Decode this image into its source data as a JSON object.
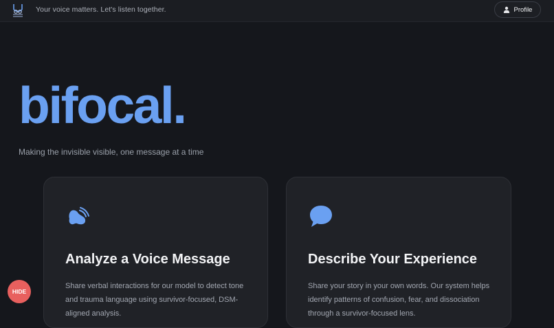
{
  "header": {
    "tagline": "Your voice matters. Let's listen together.",
    "profile_label": "Profile"
  },
  "hero": {
    "brand": "bifocal.",
    "subtitle": "Making the invisible visible, one message at a time"
  },
  "cards": [
    {
      "icon": "voice-wave-icon",
      "title": "Analyze a Voice Message",
      "description": "Share verbal interactions for our model to detect tone and trauma language using survivor-focused, DSM-aligned analysis."
    },
    {
      "icon": "speech-bubble-icon",
      "title": "Describe Your Experience",
      "description": "Share your story in your own words. Our system helps identify patterns of confusion, fear, and dissociation through a survivor-focused lens."
    }
  ],
  "hide_button": {
    "label": "HIDE"
  },
  "colors": {
    "accent": "#6aa0f1",
    "background": "#15171c",
    "card": "#202227",
    "hide": "#e8605e"
  }
}
